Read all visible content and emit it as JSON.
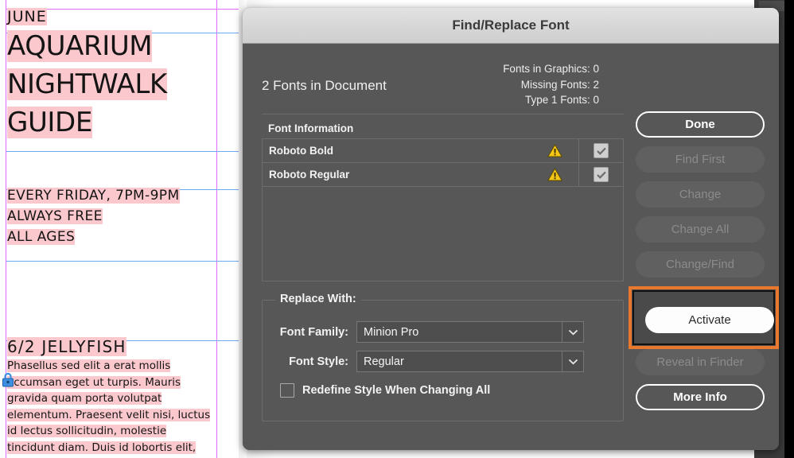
{
  "document_panel": {
    "poster": {
      "kicker": "JUNE",
      "title_line1": "AQUARIUM",
      "title_line2": "NIGHTWALK",
      "title_line3": "GUIDE",
      "detail_line1": "EVERY FRIDAY, 7PM-9PM",
      "detail_line2": "ALWAYS FREE",
      "detail_line3": "ALL AGES",
      "entry_heading": "6/2 JELLYFISH",
      "entry_body": "Phasellus sed elit a erat mollis accumsan eget ut turpis. Mauris gravida quam porta volutpat elementum. Praesent velit nisi, luctus id lectus sollicitudin, molestie tincidunt diam. Duis id lobortis elit,",
      "lock_icon": "lock-icon",
      "missing_font_highlight_color": "#fbc9cd",
      "margin_guide_color": "#e46bff",
      "baseline_guide_color": "#6fa8f5"
    }
  },
  "dialog": {
    "title": "Find/Replace Font",
    "summary": {
      "fonts_in_document": "2 Fonts in Document",
      "fonts_in_graphics": "Fonts in Graphics: 0",
      "missing_fonts": "Missing Fonts: 2",
      "type1_fonts": "Type 1 Fonts: 0"
    },
    "font_list": {
      "header": "Font Information",
      "rows": [
        {
          "name": "Roboto Bold",
          "status_icon": "warning-triangle-icon",
          "checked": true
        },
        {
          "name": "Roboto Regular",
          "status_icon": "warning-triangle-icon",
          "checked": true
        }
      ]
    },
    "replace_with": {
      "legend": "Replace With:",
      "font_family_label": "Font Family:",
      "font_family_value": "Minion Pro",
      "font_style_label": "Font Style:",
      "font_style_value": "Regular",
      "redefine_label": "Redefine Style When Changing All",
      "redefine_checked": false
    },
    "buttons": {
      "done": "Done",
      "find_first": "Find First",
      "change": "Change",
      "change_all": "Change All",
      "change_find": "Change/Find",
      "activate": "Activate",
      "reveal_in_finder": "Reveal in Finder",
      "more_info": "More Info"
    },
    "highlight": {
      "target": "Activate",
      "color": "#e8782d"
    }
  }
}
